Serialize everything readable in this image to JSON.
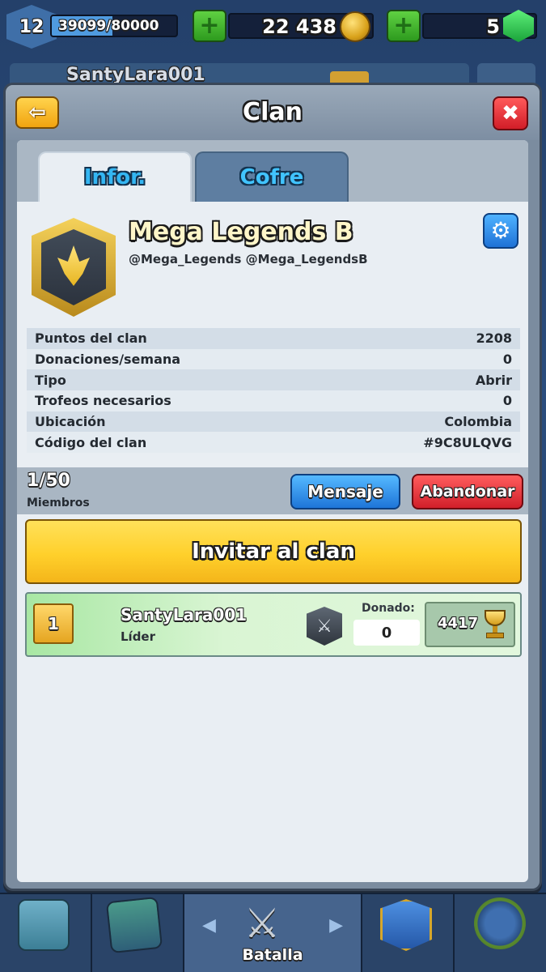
{
  "hud": {
    "level": "12",
    "xp_text": "39099/80000",
    "xp_fraction": 0.49,
    "gold": "22 438",
    "gems": "5",
    "plus_icon": "plus-icon",
    "coin_icon": "coin-icon",
    "gem_icon": "gem-icon"
  },
  "behind": {
    "profile_name": "SantyLara001"
  },
  "panel": {
    "title": "Clan",
    "back_icon": "back-arrow-icon",
    "close_icon": "close-icon",
    "back_glyph": "⇦",
    "close_glyph": "✖"
  },
  "tabs": [
    {
      "label": "Infor.",
      "active": true
    },
    {
      "label": "Cofre",
      "active": false
    }
  ],
  "clan": {
    "name": "Mega Legends B",
    "description": "@Mega_Legends @Mega_LegendsB",
    "settings_glyph": "⚙"
  },
  "stats": [
    {
      "label": "Puntos del clan",
      "value": "2208"
    },
    {
      "label": "Donaciones/semana",
      "value": "0"
    },
    {
      "label": "Tipo",
      "value": "Abrir"
    },
    {
      "label": "Trofeos necesarios",
      "value": "0"
    },
    {
      "label": "Ubicación",
      "value": "Colombia"
    },
    {
      "label": "Código del clan",
      "value": "#9C8ULQVG"
    }
  ],
  "members_bar": {
    "count": "1/50",
    "label": "Miembros",
    "message_button": "Mensaje",
    "leave_button": "Abandonar"
  },
  "invite_button": "Invitar al clan",
  "members": [
    {
      "rank": "1",
      "name": "SantyLara001",
      "role": "Líder",
      "donated_label": "Donado:",
      "donated": "0",
      "trophies": "4417"
    }
  ],
  "bottom_nav": {
    "battle_label": "Batalla",
    "arrow_left": "◀",
    "arrow_right": "▶",
    "battle_glyph": "⚔"
  },
  "colors": {
    "accent_blue": "#34b6f2",
    "gold": "#ffd02b",
    "danger": "#d11f2a",
    "success": "#2e9b1f"
  }
}
